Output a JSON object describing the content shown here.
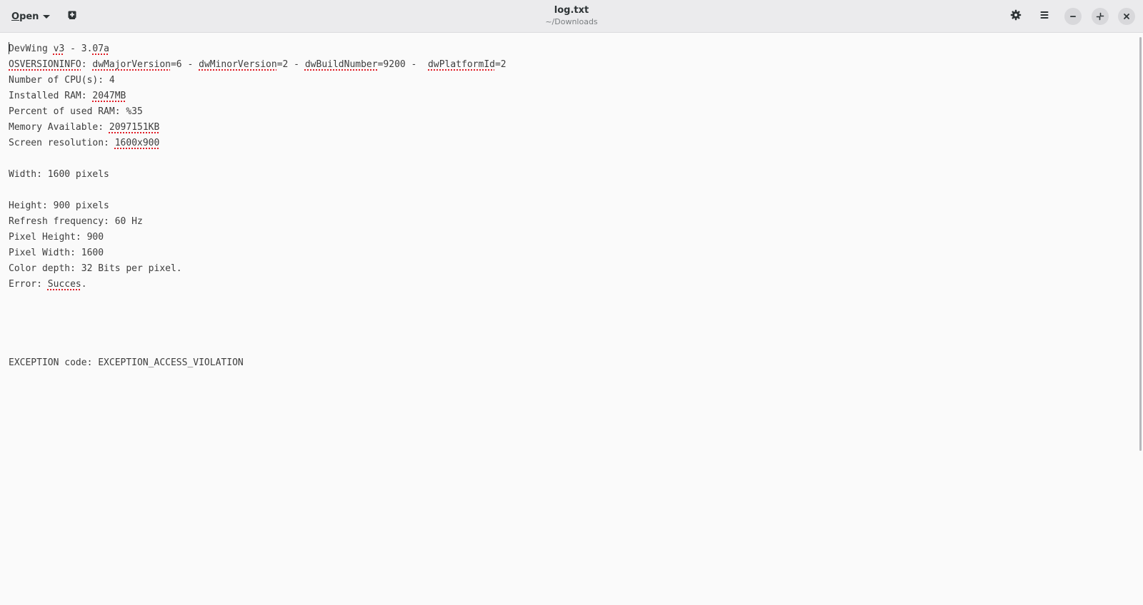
{
  "window": {
    "title": "log.txt",
    "subtitle": "~/Downloads"
  },
  "toolbar": {
    "open_label_mnemonic": "O",
    "open_label_rest": "pen",
    "new_tab_icon": "new-document-icon",
    "settings_icon": "gear-icon",
    "menu_icon": "hamburger-menu-icon",
    "minimize_icon": "minimize-icon",
    "restore_icon": "restore-icon",
    "close_icon": "close-icon"
  },
  "editor": {
    "lines": [
      [
        {
          "t": "DevWing "
        },
        {
          "t": "v3",
          "sp": true
        },
        {
          "t": " - 3."
        },
        {
          "t": "07a",
          "sp": true
        }
      ],
      [
        {
          "t": "OSVERSIONINFO",
          "sp": true
        },
        {
          "t": ": "
        },
        {
          "t": "dwMajorVersion",
          "sp": true
        },
        {
          "t": "=6 - "
        },
        {
          "t": "dwMinorVersion",
          "sp": true
        },
        {
          "t": "=2 - "
        },
        {
          "t": "dwBuildNumber",
          "sp": true
        },
        {
          "t": "=9200 -  "
        },
        {
          "t": "dwPlatformId",
          "sp": true
        },
        {
          "t": "=2"
        }
      ],
      [
        {
          "t": "Number of CPU(s): 4"
        }
      ],
      [
        {
          "t": "Installed RAM: "
        },
        {
          "t": "2047MB",
          "sp": true
        }
      ],
      [
        {
          "t": "Percent of used RAM: %35"
        }
      ],
      [
        {
          "t": "Memory Available: "
        },
        {
          "t": "2097151KB",
          "sp": true
        }
      ],
      [
        {
          "t": "Screen resolution: "
        },
        {
          "t": "1600x900",
          "sp": true
        }
      ],
      [
        {
          "t": ""
        }
      ],
      [
        {
          "t": "Width: 1600 pixels"
        }
      ],
      [
        {
          "t": ""
        }
      ],
      [
        {
          "t": "Height: 900 pixels"
        }
      ],
      [
        {
          "t": "Refresh frequency: 60 Hz"
        }
      ],
      [
        {
          "t": "Pixel Height: 900"
        }
      ],
      [
        {
          "t": "Pixel Width: 1600"
        }
      ],
      [
        {
          "t": "Color depth: 32 Bits per pixel."
        }
      ],
      [
        {
          "t": "Error: "
        },
        {
          "t": "Succes",
          "sp": true
        },
        {
          "t": "."
        }
      ],
      [
        {
          "t": ""
        }
      ],
      [
        {
          "t": ""
        }
      ],
      [
        {
          "t": ""
        }
      ],
      [
        {
          "t": ""
        }
      ],
      [
        {
          "t": "EXCEPTION code: EXCEPTION_ACCESS_VIOLATION"
        }
      ]
    ]
  },
  "colors": {
    "headerbar": "#ebebed",
    "background": "#fafafa",
    "text": "#3d3d3d",
    "spellcheck": "#e01b24"
  }
}
